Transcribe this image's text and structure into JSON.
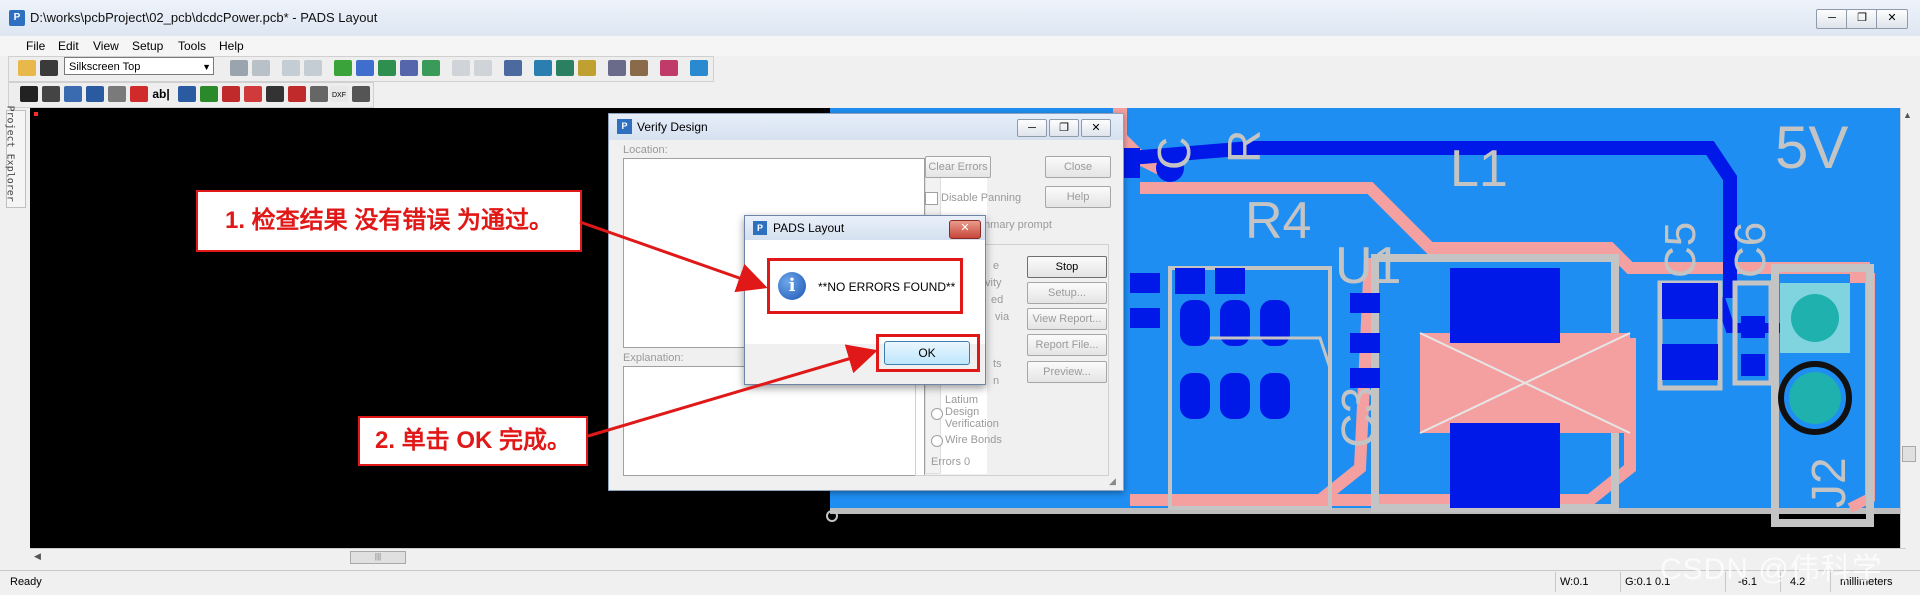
{
  "window": {
    "title": "D:\\works\\pcbProject\\02_pcb\\dcdcPower.pcb* - PADS Layout",
    "controls": {
      "minimize": "─",
      "restore": "❐",
      "close": "✕"
    }
  },
  "menu": [
    "File",
    "Edit",
    "View",
    "Setup",
    "Tools",
    "Help"
  ],
  "toolbar": {
    "layer_select": "Silkscreen Top"
  },
  "explorer_tab": "Project Explorer",
  "pcb": {
    "labels": {
      "c": "C",
      "r": "R",
      "r4": "R4",
      "u1": "U1",
      "l1": "L1",
      "c5": "C5",
      "c6": "C6",
      "c3": "C3",
      "v": "5V",
      "j2": "J2"
    },
    "colors": {
      "board": "#1f8ef2",
      "trace": "#f4a0a0",
      "pad": "#0018e8",
      "outline": "#c4c4c4",
      "teal": "#1fb1ad"
    }
  },
  "verify_dialog": {
    "title": "Verify Design",
    "location_label": "Location:",
    "explanation_label": "Explanation:",
    "clear_errors": "Clear Errors",
    "close": "Close",
    "disable_panning": "Disable Panning",
    "help": "Help",
    "summary_prompt": "mmary prompt",
    "stop": "Stop",
    "setup": "Setup...",
    "view_report": "View Report...",
    "report_file": "Report File...",
    "preview": "Preview...",
    "partial_labels": [
      "e",
      "vity",
      "ed",
      "via",
      "ts",
      "n"
    ],
    "latium": "Latium",
    "design": "Design",
    "verification": "Verification",
    "wire_bonds": "Wire Bonds",
    "errors": "Errors  0"
  },
  "message_box": {
    "title": "PADS Layout",
    "close": "✕",
    "message": "**NO ERRORS FOUND**",
    "ok": "OK"
  },
  "annotations": {
    "step1": "1. 检查结果 没有错误 为通过。",
    "step2": "2. 单击 OK 完成。"
  },
  "status": {
    "ready": "Ready",
    "w": "W:0.1",
    "g": "G:0.1 0.1",
    "x": "-6.1",
    "y": "4.2",
    "units": "millimeters"
  },
  "watermark": "CSDN @伟科学"
}
